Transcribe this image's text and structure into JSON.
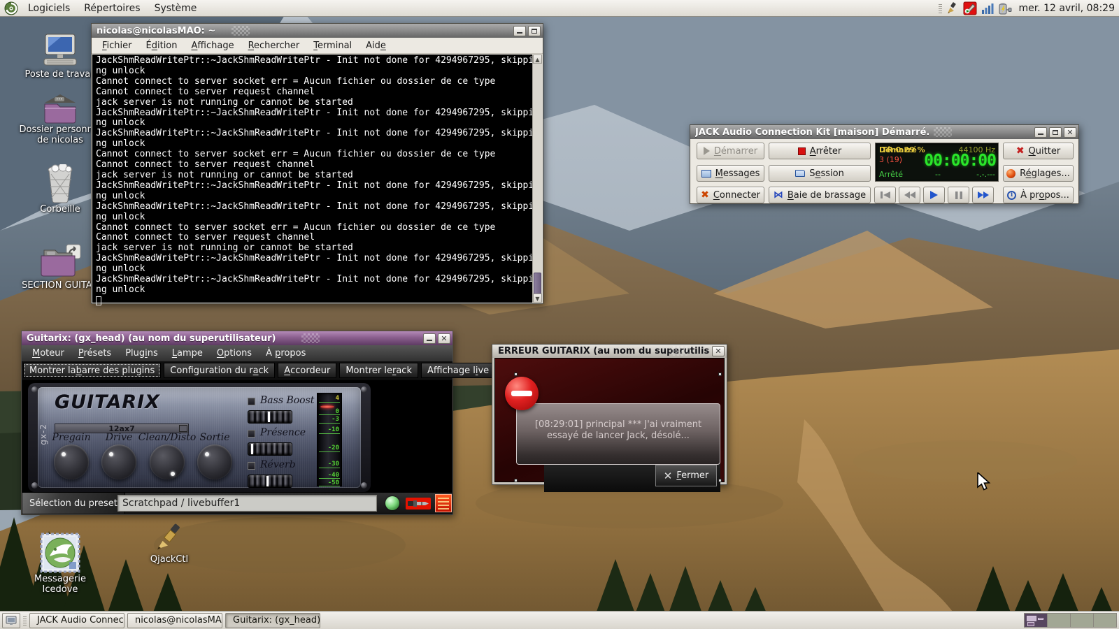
{
  "palette": {
    "panel_bg": "#ece9e2",
    "terminal_bg": "#000000",
    "guitarix_titlebar": "#8a5f8e",
    "lcd_green": "#2ae62a",
    "lcd_yellow": "#e6c93c",
    "lcd_red": "#ff5242",
    "error_red": "#d42020"
  },
  "top_panel": {
    "menus": [
      {
        "label": "Logiciels"
      },
      {
        "label": "Répertoires"
      },
      {
        "label": "Système"
      }
    ],
    "clock": "mer. 12 avril, 08:29"
  },
  "desktop_icons": [
    {
      "label": "Poste de travail"
    },
    {
      "label": "Dossier personnel de nicolas"
    },
    {
      "label": "Corbeille"
    },
    {
      "label": "SECTION GUITAR"
    },
    {
      "label": "Messagerie Icedove"
    },
    {
      "label": "QjackCtl"
    }
  ],
  "terminal": {
    "title": "nicolas@nicolasMAO: ~",
    "menu": [
      {
        "label": "Fichier",
        "accel": 0
      },
      {
        "label": "Édition",
        "accel": 1
      },
      {
        "label": "Affichage",
        "accel": 0
      },
      {
        "label": "Rechercher",
        "accel": 0
      },
      {
        "label": "Terminal",
        "accel": 0
      },
      {
        "label": "Aide",
        "accel": 3
      }
    ],
    "lines": [
      "JackShmReadWritePtr::~JackShmReadWritePtr - Init not done for 4294967295, skippi",
      "ng unlock",
      "Cannot connect to server socket err = Aucun fichier ou dossier de ce type",
      "Cannot connect to server request channel",
      "jack server is not running or cannot be started",
      "JackShmReadWritePtr::~JackShmReadWritePtr - Init not done for 4294967295, skippi",
      "ng unlock",
      "JackShmReadWritePtr::~JackShmReadWritePtr - Init not done for 4294967295, skippi",
      "ng unlock",
      "Cannot connect to server socket err = Aucun fichier ou dossier de ce type",
      "Cannot connect to server request channel",
      "jack server is not running or cannot be started",
      "JackShmReadWritePtr::~JackShmReadWritePtr - Init not done for 4294967295, skippi",
      "ng unlock",
      "JackShmReadWritePtr::~JackShmReadWritePtr - Init not done for 4294967295, skippi",
      "ng unlock",
      "Cannot connect to server socket err = Aucun fichier ou dossier de ce type",
      "Cannot connect to server request channel",
      "jack server is not running or cannot be started",
      "JackShmReadWritePtr::~JackShmReadWritePtr - Init not done for 4294967295, skippi",
      "ng unlock",
      "JackShmReadWritePtr::~JackShmReadWritePtr - Init not done for 4294967295, skippi",
      "ng unlock"
    ]
  },
  "jack": {
    "title": "JACK Audio Connection Kit [maison] Démarré.",
    "buttons": {
      "start": {
        "label": "Démarrer",
        "accel": 0
      },
      "stop": {
        "label": "Arrêter",
        "accel": 0
      },
      "messages": {
        "label": "Messages",
        "accel": 0
      },
      "session": {
        "label": "Session",
        "accel": 1
      },
      "connect": {
        "label": "Connecter",
        "accel": 0
      },
      "patchbay": {
        "label": "Baie de brassage",
        "accel": 0
      },
      "quit": {
        "label": "Quitter",
        "accel": 0
      },
      "setup": {
        "label": "Réglages...",
        "accel": 1
      },
      "about": {
        "label": "À propos...",
        "accel": 4
      }
    },
    "lcd": {
      "status": "Démarré",
      "dsp": "TR 0.29 %",
      "rate": "44100 Hz",
      "xruns": "3 (19)",
      "time": "00:00:00",
      "state": "Arrêté",
      "dash": "--",
      "session_time": "-.-.---"
    }
  },
  "guitarix": {
    "title": "Guitarix: (gx_head) (au nom du superutilisateur)",
    "menu": [
      {
        "label": "Moteur",
        "accel": 0
      },
      {
        "label": "Présets",
        "accel": 0
      },
      {
        "label": "Plugins",
        "accel": 4
      },
      {
        "label": "Lampe",
        "accel": 0
      },
      {
        "label": "Options",
        "accel": 0
      },
      {
        "label": "À propos",
        "accel": 2
      }
    ],
    "toolbar": [
      {
        "label": "Montrer la barre des plugins",
        "accel": 11
      },
      {
        "label": "Configuration du rack",
        "accel": 18
      },
      {
        "label": "Accordeur",
        "accel": 0
      },
      {
        "label": "Montrer le rack",
        "accel": 11
      },
      {
        "label": "Affichage live",
        "accel": 11
      }
    ],
    "amp": {
      "logo": "GUITARIX",
      "side_label": "gx-2",
      "tube": "12ax7",
      "knobs": [
        {
          "label": "Pregain"
        },
        {
          "label": "Drive"
        },
        {
          "label": "Clean/Disto"
        },
        {
          "label": "Sortie"
        }
      ],
      "toggles": [
        {
          "label": "Bass Boost"
        },
        {
          "label": "Présence"
        },
        {
          "label": "Réverb"
        }
      ],
      "meter_scale": [
        "4",
        "0",
        "-3",
        "-10",
        "-20",
        "-30",
        "-40",
        "-50"
      ]
    },
    "preset": {
      "label": "Sélection du preset",
      "value": "Scratchpad / livebuffer1"
    }
  },
  "error_dialog": {
    "title": "ERREUR GUITARIX (au nom du superutilisateur)",
    "message_line1": "[08:29:01]  principal  ***  J'ai vraiment",
    "message_line2": "essayé de lancer Jack, désolé...",
    "close": {
      "label": "Fermer",
      "accel": 0
    }
  },
  "taskbar": {
    "items": [
      {
        "label": "JACK Audio Connectio..."
      },
      {
        "label": "nicolas@nicolasMAO: ~"
      },
      {
        "label": "Guitarix: (gx_head) (a..."
      }
    ]
  }
}
